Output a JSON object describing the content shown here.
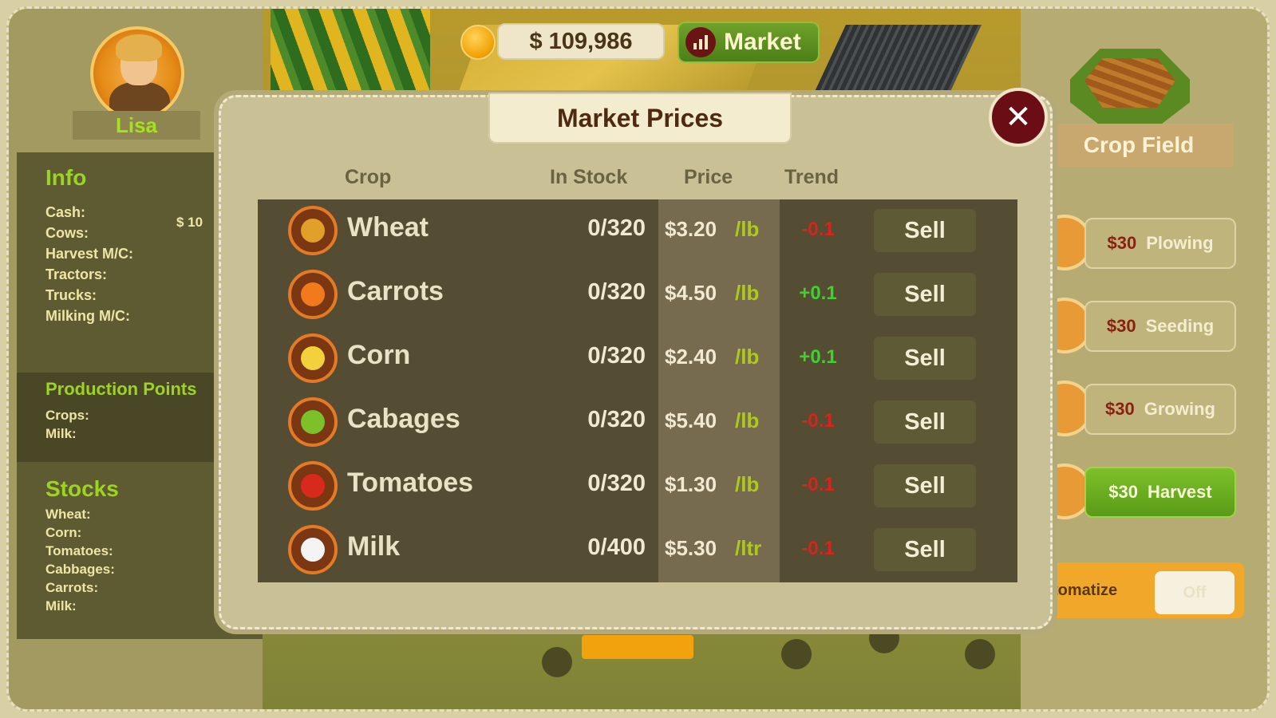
{
  "topbar": {
    "cash": "$ 109,986",
    "market_label": "Market"
  },
  "player": {
    "name": "Lisa"
  },
  "left": {
    "info_title": "Info",
    "info_items": [
      "Cash:",
      "Cows:",
      "Harvest M/C:",
      "Tractors:",
      "Trucks:",
      "Milking M/C:"
    ],
    "cash_value": "$ 10",
    "production_title": "Production Points",
    "production_items": [
      "Crops:",
      "Milk:"
    ],
    "stocks_title": "Stocks",
    "stocks_items": [
      "Wheat:",
      "Corn:",
      "Tomatoes:",
      "Cabbages:",
      "Carrots:",
      "Milk:"
    ]
  },
  "right": {
    "crop_field_label": "Crop Field",
    "actions": [
      {
        "cost": "$30",
        "label": "Plowing",
        "active": false
      },
      {
        "cost": "$30",
        "label": "Seeding",
        "active": false
      },
      {
        "cost": "$30",
        "label": "Growing",
        "active": false
      },
      {
        "cost": "$30",
        "label": "Harvest",
        "active": true
      }
    ],
    "automate_label": "tomatize",
    "automate_value": "Off"
  },
  "modal": {
    "title": "Market Prices",
    "columns": {
      "crop": "Crop",
      "stock": "In Stock",
      "price": "Price",
      "trend": "Trend"
    },
    "rows": [
      {
        "name": "Wheat",
        "icon": "wheat-icon",
        "stock": "0/320",
        "price": "$3.20",
        "unit": "/lb",
        "trend": "-0.1",
        "trend_color": "#d8241c",
        "sell": "Sell"
      },
      {
        "name": "Carrots",
        "icon": "carrot-icon",
        "stock": "0/320",
        "price": "$4.50",
        "unit": "/lb",
        "trend": "+0.1",
        "trend_color": "#3fd12c",
        "sell": "Sell"
      },
      {
        "name": "Corn",
        "icon": "corn-icon",
        "stock": "0/320",
        "price": "$2.40",
        "unit": "/lb",
        "trend": "+0.1",
        "trend_color": "#3fd12c",
        "sell": "Sell"
      },
      {
        "name": "Cabages",
        "icon": "cabbage-icon",
        "stock": "0/320",
        "price": "$5.40",
        "unit": "/lb",
        "trend": "-0.1",
        "trend_color": "#d8241c",
        "sell": "Sell"
      },
      {
        "name": "Tomatoes",
        "icon": "tomato-icon",
        "stock": "0/320",
        "price": "$1.30",
        "unit": "/lb",
        "trend": "-0.1",
        "trend_color": "#d8241c",
        "sell": "Sell"
      },
      {
        "name": "Milk",
        "icon": "milk-icon",
        "stock": "0/400",
        "price": "$5.30",
        "unit": "/ltr",
        "trend": "-0.1",
        "trend_color": "#d8241c",
        "sell": "Sell"
      }
    ]
  }
}
